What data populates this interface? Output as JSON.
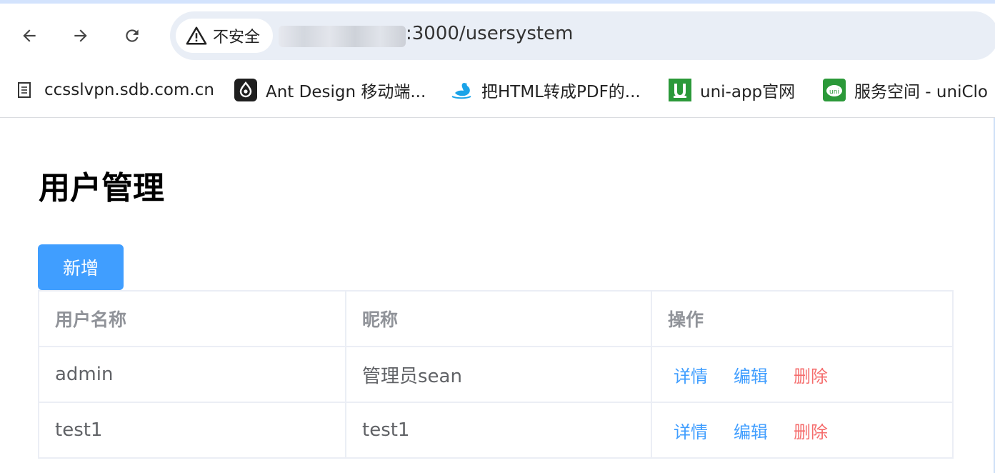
{
  "browser": {
    "security_label": "不安全",
    "url_suffix": ":3000/usersystem",
    "bookmarks": [
      {
        "label": "ccsslvpn.sdb.com.cn",
        "icon": "document-icon"
      },
      {
        "label": "Ant Design 移动端...",
        "icon": "ant-design-icon"
      },
      {
        "label": "把HTML转成PDF的...",
        "icon": "swan-icon"
      },
      {
        "label": "uni-app官网",
        "icon": "uni-app-icon"
      },
      {
        "label": "服务空间 - uniClo",
        "icon": "unicloud-icon"
      }
    ]
  },
  "page": {
    "title": "用户管理",
    "add_label": "新增"
  },
  "table": {
    "headers": [
      "用户名称",
      "昵称",
      "操作"
    ],
    "rows": [
      {
        "username": "admin",
        "nickname": "管理员sean"
      },
      {
        "username": "test1",
        "nickname": "test1"
      }
    ],
    "actions": {
      "detail": "详情",
      "edit": "编辑",
      "delete": "删除"
    }
  },
  "colors": {
    "primary": "#409eff",
    "danger": "#f56c6c",
    "header_text": "#909399",
    "cell_text": "#606266",
    "border": "#ebeef5"
  }
}
